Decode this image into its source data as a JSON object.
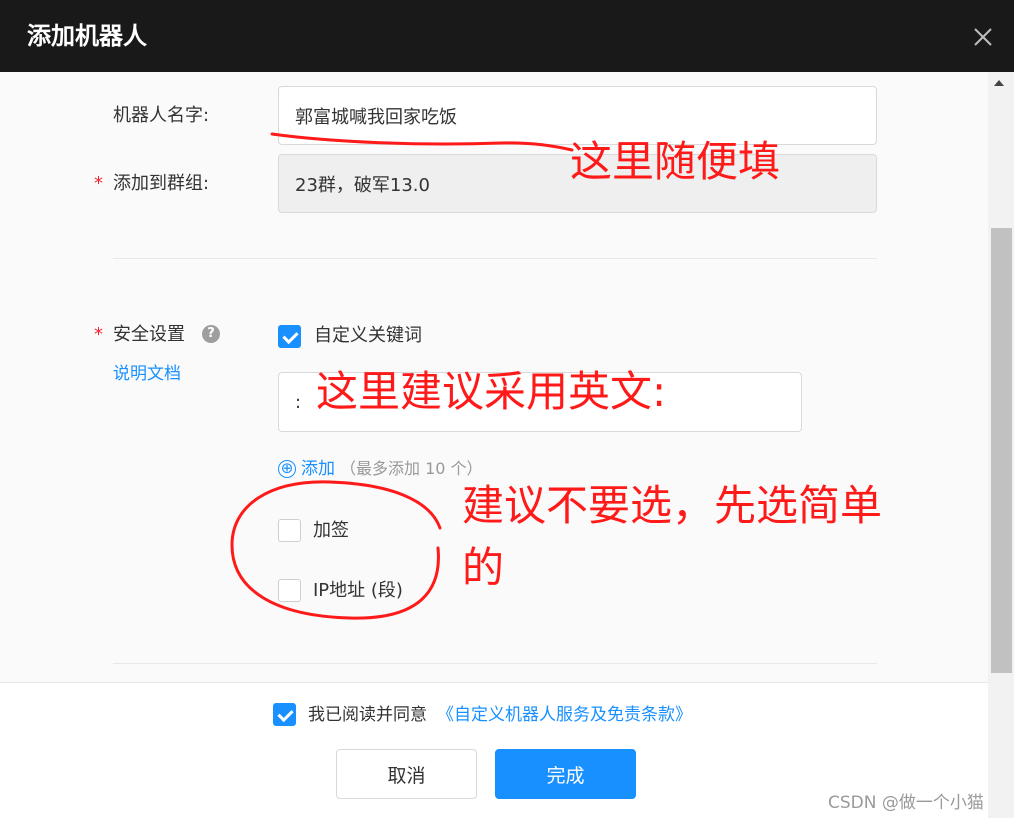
{
  "dialog": {
    "title": "添加机器人"
  },
  "form": {
    "robot_name": {
      "label": "机器人名字:",
      "value": "郭富城喊我回家吃饭"
    },
    "group": {
      "required_mark": "*",
      "label": "添加到群组:",
      "value": "23群，破军13.0"
    },
    "security": {
      "required_mark": "*",
      "label": "安全设置",
      "help_icon": "?",
      "doc_link": "说明文档",
      "options": {
        "custom_keyword": {
          "label": "自定义关键词",
          "checked": true
        },
        "keyword_value": ":",
        "add_link": "添加",
        "add_hint": "（最多添加 10 个）",
        "add_icon": "⊕",
        "sign": {
          "label": "加签",
          "checked": false
        },
        "ip": {
          "label": "IP地址 (段)",
          "checked": false
        }
      }
    }
  },
  "footer": {
    "agree_checked": true,
    "agree_text": "我已阅读并同意",
    "agree_link": "《自定义机器人服务及免责条款》",
    "cancel_label": "取消",
    "ok_label": "完成"
  },
  "annotations": {
    "note1": "这里随便填",
    "note2": "这里建议采用英文:",
    "note3_line1": "建议不要选，先选简单",
    "note3_line2": "的"
  },
  "watermark": "CSDN @做一个小猫",
  "colors": {
    "titlebar": "#191919",
    "primary": "#1890ff",
    "required": "#f5222d",
    "annotation": "#ff1a1a"
  },
  "icons": {
    "close": "close-icon",
    "help": "question-circle-icon",
    "add": "plus-circle-icon",
    "scroll_up": "caret-up-icon"
  }
}
